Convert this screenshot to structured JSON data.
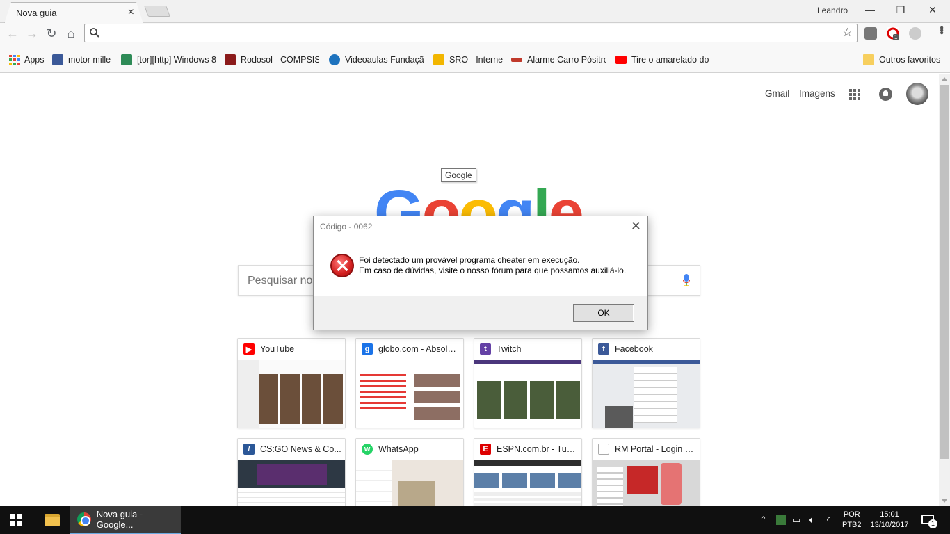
{
  "window": {
    "tab_title": "Nova guia",
    "tab_close": "×",
    "profile_name": "Leandro",
    "minimize": "—",
    "restore": "❐",
    "close": "✕"
  },
  "toolbar": {
    "omnibox_value": "",
    "extension_badge": "1"
  },
  "bookmarks": {
    "items": [
      {
        "label": "Apps",
        "icon": "apps-grid-icon",
        "color": "#e94235"
      },
      {
        "label": "motor mille",
        "icon": "bookmark-favicon",
        "color": "#3b5998"
      },
      {
        "label": "[tor][http] Windows 8",
        "icon": "bookmark-favicon",
        "color": "#2e8b57"
      },
      {
        "label": "Rodosol - COMPSIS -",
        "icon": "bookmark-favicon",
        "color": "#8b1a1a"
      },
      {
        "label": "Videoaulas Fundação",
        "icon": "bookmark-favicon",
        "color": "#1e73be"
      },
      {
        "label": "SRO - Internet",
        "icon": "bookmark-favicon",
        "color": "#f2b600"
      },
      {
        "label": "Alarme Carro Pósitron",
        "icon": "bookmark-favicon",
        "color": "#c0392b"
      },
      {
        "label": "Tire o amarelado do f",
        "icon": "youtube-icon",
        "color": "#ff0000"
      }
    ],
    "other": "Outros favoritos"
  },
  "ntp": {
    "gmail": "Gmail",
    "images": "Imagens",
    "tooltip": "Google",
    "logo_letters": [
      {
        "ch": "G",
        "color": "#4285f4"
      },
      {
        "ch": "o",
        "color": "#ea4335"
      },
      {
        "ch": "o",
        "color": "#fbbc05"
      },
      {
        "ch": "g",
        "color": "#4285f4"
      },
      {
        "ch": "l",
        "color": "#34a853"
      },
      {
        "ch": "e",
        "color": "#ea4335"
      }
    ],
    "search_placeholder": "Pesquisar no Google ou digitar URL",
    "tiles": [
      {
        "title": "YouTube",
        "fav_color": "#ff0000",
        "fav_char": "▶"
      },
      {
        "title": "globo.com - Absolut...",
        "fav_color": "#1a73e8",
        "fav_char": "g"
      },
      {
        "title": "Twitch",
        "fav_color": "#6441a5",
        "fav_char": "t"
      },
      {
        "title": "Facebook",
        "fav_color": "#3b5998",
        "fav_char": "f"
      },
      {
        "title": "CS:GO News & Co...",
        "fav_color": "#2b5797",
        "fav_char": "/"
      },
      {
        "title": "WhatsApp",
        "fav_color": "#25d366",
        "fav_char": "w"
      },
      {
        "title": "ESPN.com.br - Tud...",
        "fav_color": "#d00",
        "fav_char": "E"
      },
      {
        "title": "RM Portal - Login V...",
        "fav_color": "#ffffff",
        "fav_char": ""
      }
    ]
  },
  "dialog": {
    "title": "Código - 0062",
    "line1": "Foi detectado um provável programa cheater em execução.",
    "line2": "Em caso de dúvidas, visite o nosso fórum para que possamos auxiliá-lo.",
    "ok": "OK",
    "close": "✕"
  },
  "taskbar": {
    "chrome_label": "Nova guia - Google...",
    "lang_line1": "POR",
    "lang_line2": "PTB2",
    "time": "15:01",
    "date": "13/10/2017",
    "notif_count": "1"
  }
}
